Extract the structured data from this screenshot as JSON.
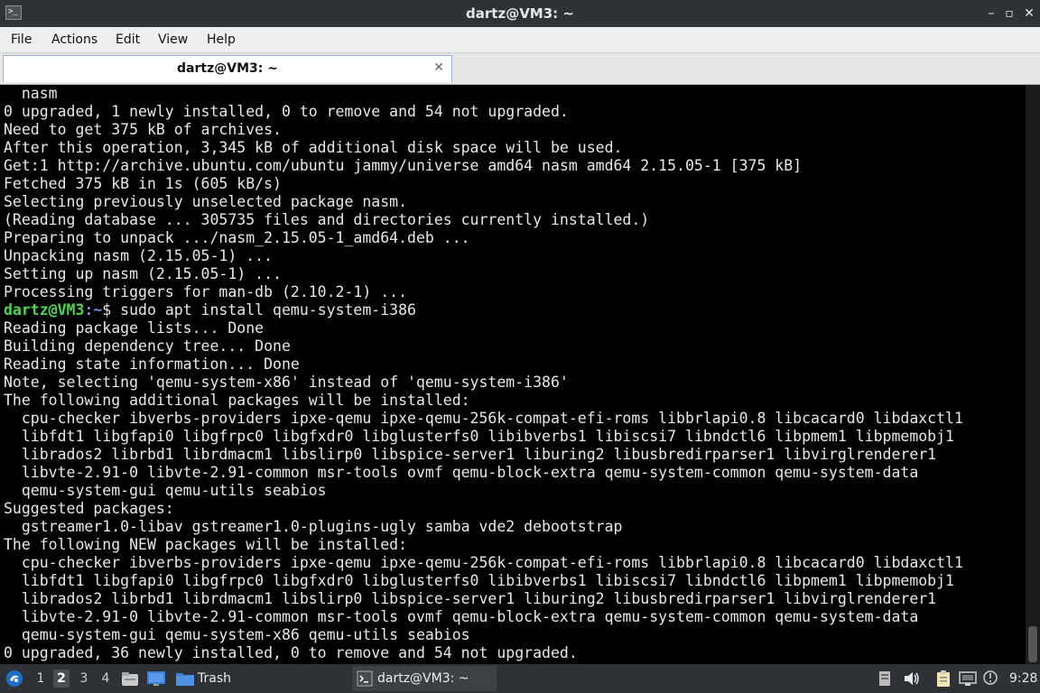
{
  "window": {
    "title": "dartz@VM3: ~",
    "icons": {
      "app": "terminal-icon",
      "minimize": "minimize-icon",
      "maximize": "maximize-icon",
      "close": "close-icon"
    }
  },
  "menubar": {
    "items": [
      "File",
      "Actions",
      "Edit",
      "View",
      "Help"
    ]
  },
  "tab": {
    "label": "dartz@VM3: ~"
  },
  "terminal": {
    "colors": {
      "background": "#000000",
      "text": "#e8e8e8",
      "prompt_user": "#4fd64f",
      "prompt_path": "#6a8ee8"
    },
    "lines": [
      "  nasm",
      "0 upgraded, 1 newly installed, 0 to remove and 54 not upgraded.",
      "Need to get 375 kB of archives.",
      "After this operation, 3,345 kB of additional disk space will be used.",
      "Get:1 http://archive.ubuntu.com/ubuntu jammy/universe amd64 nasm amd64 2.15.05-1 [375 kB]",
      "Fetched 375 kB in 1s (605 kB/s)",
      "Selecting previously unselected package nasm.",
      "(Reading database ... 305735 files and directories currently installed.)",
      "Preparing to unpack .../nasm_2.15.05-1_amd64.deb ...",
      "Unpacking nasm (2.15.05-1) ...",
      "Setting up nasm (2.15.05-1) ...",
      "Processing triggers for man-db (2.10.2-1) ...",
      {
        "prompt": {
          "user": "dartz@VM3",
          "path": ":~",
          "symbol": "$ ",
          "command": "sudo apt install qemu-system-i386"
        }
      },
      "Reading package lists... Done",
      "Building dependency tree... Done",
      "Reading state information... Done",
      "Note, selecting 'qemu-system-x86' instead of 'qemu-system-i386'",
      "The following additional packages will be installed:",
      "  cpu-checker ibverbs-providers ipxe-qemu ipxe-qemu-256k-compat-efi-roms libbrlapi0.8 libcacard0 libdaxctl1",
      "  libfdt1 libgfapi0 libgfrpc0 libgfxdr0 libglusterfs0 libibverbs1 libiscsi7 libndctl6 libpmem1 libpmemobj1",
      "  librados2 librbd1 librdmacm1 libslirp0 libspice-server1 liburing2 libusbredirparser1 libvirglrenderer1",
      "  libvte-2.91-0 libvte-2.91-common msr-tools ovmf qemu-block-extra qemu-system-common qemu-system-data",
      "  qemu-system-gui qemu-utils seabios",
      "Suggested packages:",
      "  gstreamer1.0-libav gstreamer1.0-plugins-ugly samba vde2 debootstrap",
      "The following NEW packages will be installed:",
      "  cpu-checker ibverbs-providers ipxe-qemu ipxe-qemu-256k-compat-efi-roms libbrlapi0.8 libcacard0 libdaxctl1",
      "  libfdt1 libgfapi0 libgfrpc0 libgfxdr0 libglusterfs0 libibverbs1 libiscsi7 libndctl6 libpmem1 libpmemobj1",
      "  librados2 librbd1 librdmacm1 libslirp0 libspice-server1 liburing2 libusbredirparser1 libvirglrenderer1",
      "  libvte-2.91-0 libvte-2.91-common msr-tools ovmf qemu-block-extra qemu-system-common qemu-system-data",
      "  qemu-system-gui qemu-system-x86 qemu-utils seabios",
      "0 upgraded, 36 newly installed, 0 to remove and 54 not upgraded."
    ]
  },
  "taskbar": {
    "desktops": [
      "1",
      "2",
      "3",
      "4"
    ],
    "active_desktop": "2",
    "trash_label": "Trash",
    "task_label": "dartz@VM3: ~",
    "clock": "9:28",
    "icons": {
      "start": "lxqt-start-icon",
      "files": "file-manager-icon",
      "show_desktop": "show-desktop-icon",
      "trash": "trash-folder-icon",
      "task": "terminal-icon",
      "keyboard": "keyboard-layout-icon",
      "volume": "volume-icon",
      "clipboard": "clipboard-icon",
      "network": "network-icon",
      "notification": "notification-icon"
    }
  }
}
